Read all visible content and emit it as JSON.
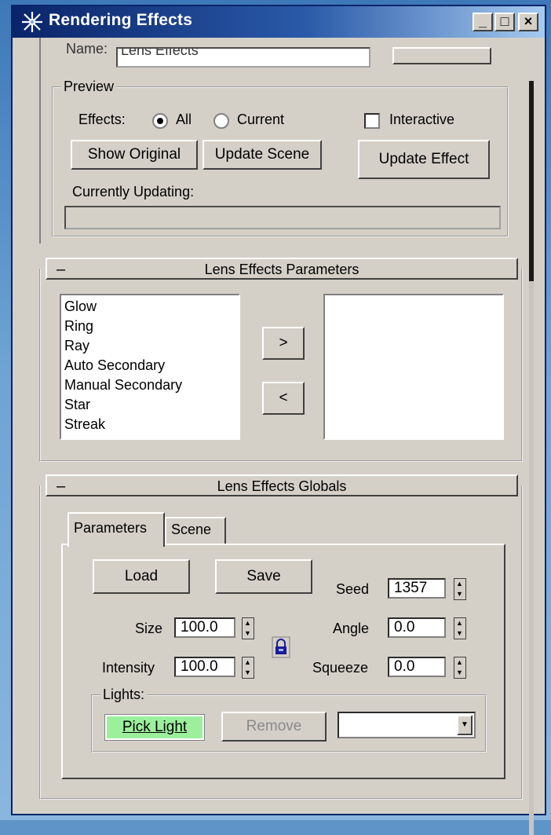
{
  "window": {
    "title": "Rendering Effects",
    "minimize_glyph": "_",
    "maximize_glyph": "□",
    "close_glyph": "×"
  },
  "name_row": {
    "label": "Name:",
    "value": "Lens Effects"
  },
  "preview": {
    "group_label": "Preview",
    "effects_label": "Effects:",
    "radio_all": "All",
    "radio_current": "Current",
    "selected": "All",
    "interactive_label": "Interactive",
    "interactive_checked": false,
    "show_original": "Show Original",
    "update_scene": "Update Scene",
    "update_effect": "Update Effect",
    "currently_updating": "Currently Updating:"
  },
  "lens_params": {
    "title": "Lens Effects Parameters",
    "collapse_glyph": "–",
    "available": [
      "Glow",
      "Ring",
      "Ray",
      "Auto Secondary",
      "Manual Secondary",
      "Star",
      "Streak"
    ],
    "move_right": ">",
    "move_left": "<"
  },
  "globals": {
    "title": "Lens Effects Globals",
    "collapse_glyph": "–",
    "tabs": [
      "Parameters",
      "Scene"
    ],
    "active_tab": "Parameters",
    "load": "Load",
    "save": "Save",
    "seed_label": "Seed",
    "seed_value": "1357",
    "size_label": "Size",
    "size_value": "100.0",
    "angle_label": "Angle",
    "angle_value": "0.0",
    "intensity_label": "Intensity",
    "intensity_value": "100.0",
    "squeeze_label": "Squeeze",
    "squeeze_value": "0.0",
    "lights_label": "Lights:",
    "pick_light": "Pick Light",
    "remove": "Remove",
    "lights_dropdown_value": ""
  },
  "colors": {
    "title_active": "#0a246a",
    "pick_light_bg": "#9cf09c",
    "face": "#d4d0c8"
  }
}
